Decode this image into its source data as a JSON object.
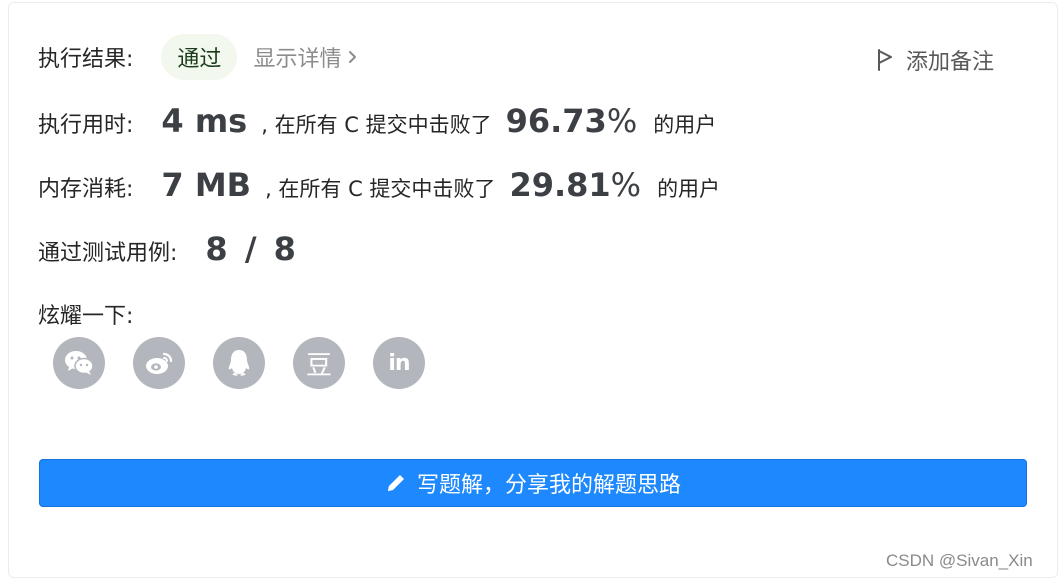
{
  "result": {
    "label": "执行结果:",
    "status": "通过",
    "details_link": "显示详情",
    "add_note": "添加备注"
  },
  "runtime": {
    "label": "执行用时:",
    "value": "4 ms",
    "beat_text": ", 在所有 C 提交中击败了",
    "percent_number": "96.73",
    "percent_sign": "%",
    "suffix": "的用户"
  },
  "memory": {
    "label": "内存消耗:",
    "value": "7 MB",
    "beat_text": ", 在所有 C 提交中击败了",
    "percent_number": "29.81",
    "percent_sign": "%",
    "suffix": "的用户"
  },
  "tests": {
    "label": "通过测试用例:",
    "value": "8 / 8"
  },
  "share": {
    "label": "炫耀一下:",
    "icons": [
      "wechat-icon",
      "weibo-icon",
      "qq-icon",
      "douban-icon",
      "linkedin-icon"
    ],
    "douban_glyph": "豆",
    "linkedin_glyph": "in"
  },
  "write_solution": {
    "label": "写题解，分享我的解题思路"
  },
  "watermark": "CSDN @Sivan_Xin",
  "colors": {
    "primary": "#1e88ff",
    "status_bg": "#f3f8ef",
    "status_text": "#1c3d1c",
    "icon_bg": "#b3b6bd"
  }
}
